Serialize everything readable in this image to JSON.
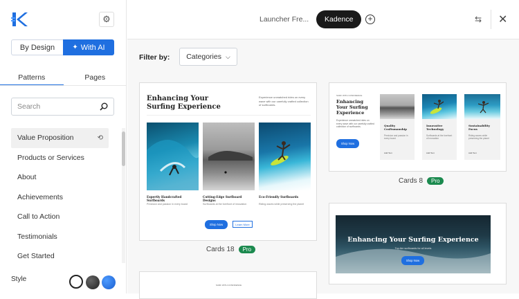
{
  "sidebar": {
    "mode_options": [
      "By Design",
      "With AI"
    ],
    "tabs": [
      "Patterns",
      "Pages"
    ],
    "search_placeholder": "Search",
    "categories": [
      {
        "label": "Value Proposition"
      },
      {
        "label": "Products or Services"
      },
      {
        "label": "About"
      },
      {
        "label": "Achievements"
      },
      {
        "label": "Call to Action"
      },
      {
        "label": "Testimonials"
      },
      {
        "label": "Get Started"
      }
    ],
    "style_label": "Style"
  },
  "topbar": {
    "breadcrumb": "Launcher Fre...",
    "active_pill": "Kadence"
  },
  "filter": {
    "label": "Filter by:",
    "dropdown": "Categories"
  },
  "cards": {
    "cards18": {
      "heading": "Enhancing Your Surfing Experience",
      "side_text": "Experience unmatched rides on every wave with our carefully crafted collection of surfboards.",
      "items": [
        {
          "title": "Expertly Handcrafted Surfboards",
          "sub": "Precision and passion in every board"
        },
        {
          "title": "Cutting-Edge Surfboard Designs",
          "sub": "Surfboards at the forefront of innovation"
        },
        {
          "title": "Eco-Friendly Surfboards",
          "sub": "Riding waves while preserving the planet"
        }
      ],
      "btn_primary": "Shop Now",
      "btn_secondary": "Learn More",
      "name": "Cards 18",
      "badge": "Pro"
    },
    "cards8": {
      "kicker": "SURF WITH CONFIDENCE",
      "heading": "Enhancing Your Surfing Experience",
      "body": "Experience unmatched rides on every wave with our carefully crafted collection of surfboards.",
      "btn": "Shop Now",
      "items": [
        {
          "title": "Quality Craftsmanship",
          "sub": "Precision and passion in every board",
          "link": "Add Text"
        },
        {
          "title": "Innovative Technology",
          "sub": "Surfboards at the forefront of innovation",
          "link": "Add Text"
        },
        {
          "title": "Sustainability Focus",
          "sub": "Riding waves while preserving the planet",
          "link": "Add Text"
        }
      ],
      "name": "Cards 8",
      "badge": "Pro"
    },
    "hero": {
      "heading": "Enhancing Your Surfing Experience",
      "sub": "Top-tier surfboards for all levels",
      "btn": "Shop Now"
    },
    "bottom": {
      "kicker": "SURF WITH CONFIDENCE"
    }
  },
  "colors": {
    "accent": "#1f6fe0",
    "pro": "#1c8a4f",
    "pill": "#1a1a1a"
  }
}
